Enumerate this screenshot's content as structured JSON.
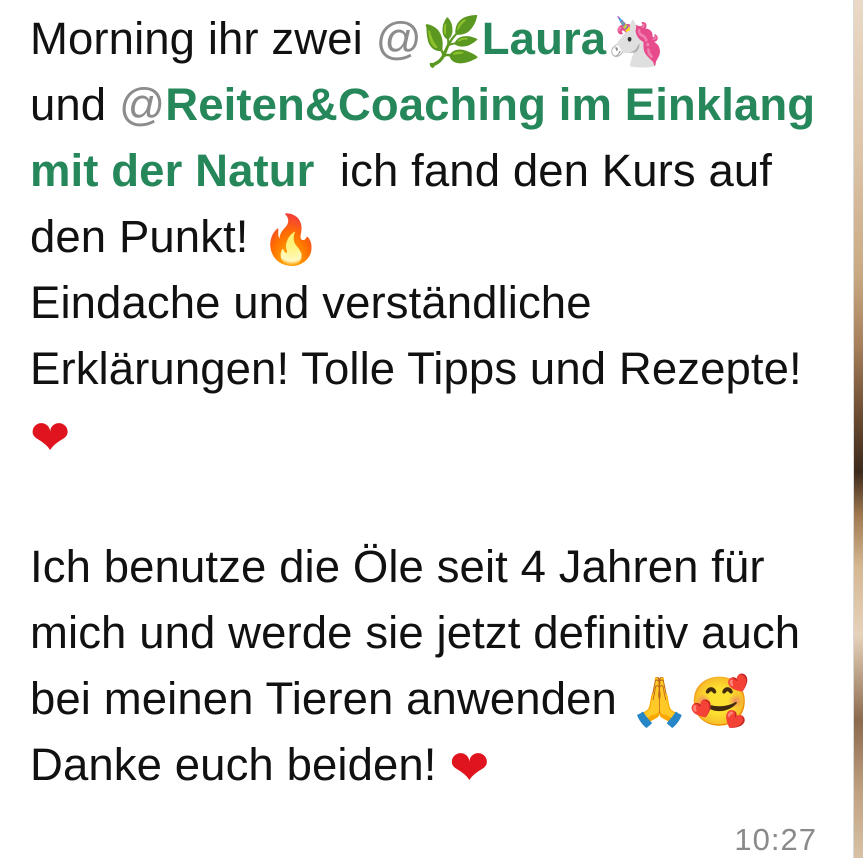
{
  "message": {
    "greeting": "Morning ihr zwei ",
    "mention1_at": "@",
    "mention1_name": "Laura",
    "connector": "und ",
    "mention2_at": "@",
    "mention2_name": "Reiten&Coaching im Einklang mit der Natur",
    "after_mention": "  ich fand den Kurs auf den Punkt! ",
    "sentence2": "Eindache und verständliche Erklärungen! Tolle Tipps und Rezepte! ",
    "paragraph2": "Ich benutze die Öle seit 4 Jahren für mich und werde sie jetzt definitiv auch bei meinen Tieren anwenden ",
    "thanks": "Danke euch beiden! ",
    "timestamp": "10:27"
  },
  "icons": {
    "leaf": "herb-icon",
    "unicorn": "unicorn-icon",
    "fire": "fire-icon",
    "heart": "red-heart-icon",
    "pray": "folded-hands-icon",
    "smile": "smiling-face-with-hearts-icon"
  },
  "colors": {
    "mention": "#25875a",
    "mention_at": "#8c8c8c",
    "text": "#111111",
    "timestamp": "#8a8a8a"
  }
}
